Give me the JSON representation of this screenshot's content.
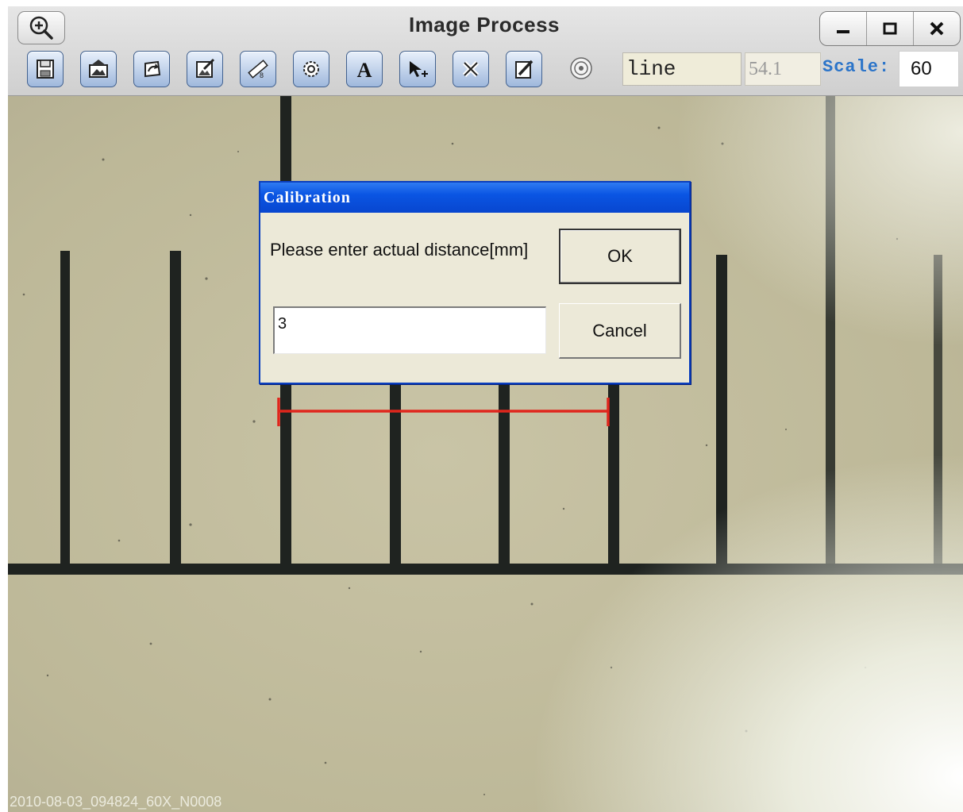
{
  "window": {
    "title": "Image Process",
    "controls": [
      "minimize",
      "maximize",
      "close"
    ]
  },
  "toolbar": {
    "zoom_icon": "zoom-in-icon",
    "tools": [
      {
        "name": "save",
        "icon": "floppy-disk-icon"
      },
      {
        "name": "open-image",
        "icon": "image-icon"
      },
      {
        "name": "undo",
        "icon": "undo-icon"
      },
      {
        "name": "edit-image",
        "icon": "edit-image-icon"
      },
      {
        "name": "ruler",
        "icon": "ruler-icon"
      },
      {
        "name": "settings",
        "icon": "gear-icon"
      },
      {
        "name": "text",
        "icon": "text-icon"
      },
      {
        "name": "select-move",
        "icon": "pointer-move-icon"
      },
      {
        "name": "delete",
        "icon": "cross-icon"
      },
      {
        "name": "pen",
        "icon": "pen-icon"
      },
      {
        "name": "target",
        "icon": "target-icon"
      }
    ],
    "shape_type": "line",
    "measured_value": "54.1",
    "scale_label": "Scale:",
    "scale_value": "60"
  },
  "image": {
    "stamp": "2010-08-03_094824_60X_N0008",
    "measure_line_color": "#e0261c",
    "background_color": "#c3bda0",
    "mark_color": "#1f2320"
  },
  "dialog": {
    "title": "Calibration",
    "prompt": "Please enter actual distance[mm]",
    "input_value": "3",
    "ok_label": "OK",
    "cancel_label": "Cancel"
  }
}
